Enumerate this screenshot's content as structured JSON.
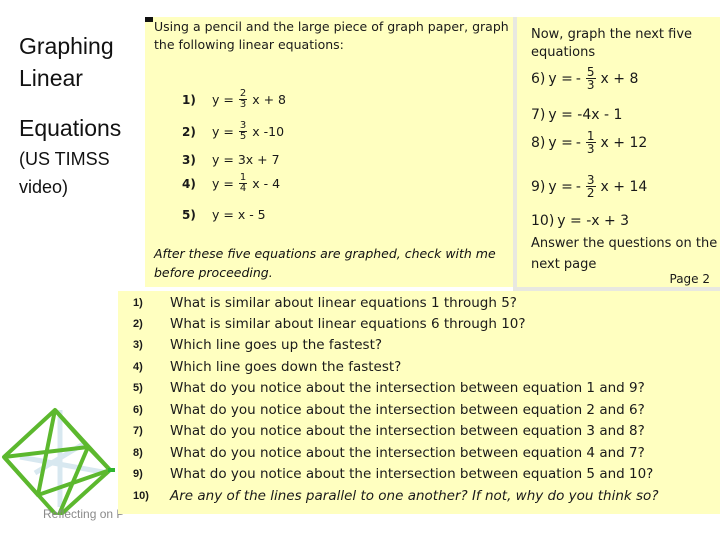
{
  "slide": {
    "title_line1": "Graphing",
    "title_line2": "Linear",
    "title_line3": "Equations",
    "subtitle_line1": "(US TIMSS",
    "subtitle_line2": "video)",
    "footer": "Reflecting on P",
    "logo_icon": "green-octahedron-wireframe-icon"
  },
  "worksheet_part1": {
    "intro": "Using a pencil and the large piece of graph paper, graph the following linear equations:",
    "equations": [
      {
        "num": "1)",
        "lhs": "y =",
        "frac_num": "2",
        "frac_den": "3",
        "sign": "",
        "rest": "x + 8"
      },
      {
        "num": "2)",
        "lhs": "y =",
        "frac_num": "3",
        "frac_den": "5",
        "sign": "",
        "rest": "x -10"
      },
      {
        "num": "3)",
        "lhs": "y = 3x + 7",
        "frac_num": "",
        "frac_den": "",
        "sign": "",
        "rest": ""
      },
      {
        "num": "4)",
        "lhs": "y =",
        "frac_num": "1",
        "frac_den": "4",
        "sign": "",
        "rest": "x - 4"
      },
      {
        "num": "5)",
        "lhs": "y = x - 5",
        "frac_num": "",
        "frac_den": "",
        "sign": "",
        "rest": ""
      }
    ],
    "note": "After these five equations are graphed, check with me before proceeding."
  },
  "worksheet_part2": {
    "intro": "Now, graph the next five equations",
    "equations": [
      {
        "num": "6)",
        "lhs": "y =",
        "sign": "-",
        "frac_num": "5",
        "frac_den": "3",
        "rest": "x + 8"
      },
      {
        "num": "7)",
        "lhs": "y = -4x - 1",
        "sign": "",
        "frac_num": "",
        "frac_den": "",
        "rest": ""
      },
      {
        "num": "8)",
        "lhs": "y =",
        "sign": "-",
        "frac_num": "1",
        "frac_den": "3",
        "rest": "x + 12"
      },
      {
        "num": "9)",
        "lhs": "y =",
        "sign": "-",
        "frac_num": "3",
        "frac_den": "2",
        "rest": "x + 14"
      },
      {
        "num": "10)",
        "lhs": "y = -x + 3",
        "sign": "",
        "frac_num": "",
        "frac_den": "",
        "rest": ""
      }
    ],
    "answer_note": "Answer the questions on the next page",
    "page_label": "Page 2"
  },
  "questions": [
    {
      "num": "1)",
      "text": "What is similar about linear equations 1 through 5?"
    },
    {
      "num": "2)",
      "text": "What is similar about linear equations 6 through 10?"
    },
    {
      "num": "3)",
      "text": "Which line goes up the fastest?"
    },
    {
      "num": "4)",
      "text": "Which line goes down the fastest?"
    },
    {
      "num": "5)",
      "text": "What do you notice about the intersection between equation 1 and 9?"
    },
    {
      "num": "6)",
      "text": "What do you notice about the intersection between equation 2 and 6?"
    },
    {
      "num": "7)",
      "text": "What do you notice about the intersection between equation 3 and 8?"
    },
    {
      "num": "8)",
      "text": "What do you notice about the intersection between equation 4 and 7?"
    },
    {
      "num": "9)",
      "text": "What do you notice about the intersection between equation 5 and 10?"
    },
    {
      "num": "10)",
      "text": "Are any of the lines parallel to one another?  If not, why do you think so?"
    }
  ],
  "colors": {
    "worksheet_background": "#ffffc0",
    "logo_green": "#5cb82e",
    "footer_text": "#8a8a8a"
  }
}
